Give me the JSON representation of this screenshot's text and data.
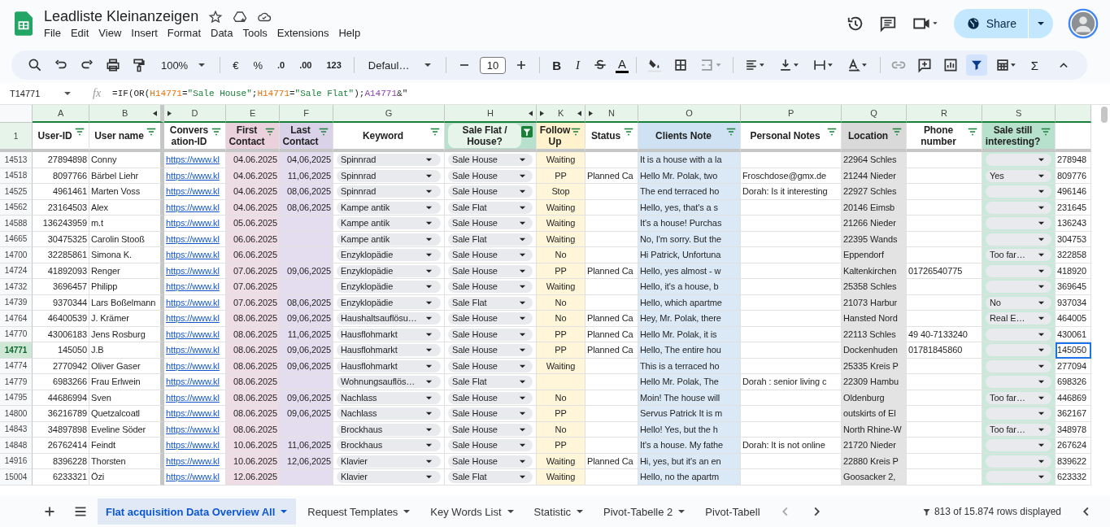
{
  "document": {
    "title": "Leadliste Kleinanzeigen"
  },
  "menu": [
    "File",
    "Edit",
    "View",
    "Insert",
    "Format",
    "Data",
    "Tools",
    "Extensions",
    "Help"
  ],
  "share": {
    "label": "Share"
  },
  "toolbar": {
    "zoom": "100%",
    "currency": "€",
    "percent": "%",
    "decrease_decimals": ".0",
    "increase_decimals": ".00",
    "number_format": "123",
    "font": "Defaul…",
    "font_size": "10",
    "bold": "B",
    "italic": "I",
    "text_color": "A",
    "sum": "Σ",
    "filter_on": true
  },
  "formula_bar": {
    "name_box": "T14771",
    "fx": "fx",
    "tokens": [
      {
        "kind": "plain",
        "text": "=IF(OR("
      },
      {
        "kind": "ref",
        "text": "H14771",
        "color": "#e8710a"
      },
      {
        "kind": "plain",
        "text": "="
      },
      {
        "kind": "string",
        "text": "\"Sale House\""
      },
      {
        "kind": "plain",
        "text": ";"
      },
      {
        "kind": "ref",
        "text": "H14771",
        "color": "#e8710a"
      },
      {
        "kind": "plain",
        "text": "="
      },
      {
        "kind": "string",
        "text": "\"Sale Flat\""
      },
      {
        "kind": "plain",
        "text": ");"
      },
      {
        "kind": "ref",
        "text": "A14771",
        "color": "#8e44ad"
      },
      {
        "kind": "plain",
        "text": "&\""
      }
    ]
  },
  "grid": {
    "header_row_number": "1",
    "columns": [
      {
        "letter": "A",
        "header": "User-ID",
        "kind": "number",
        "filter_active": false
      },
      {
        "letter": "B",
        "header": "User name",
        "kind": "text",
        "filter_active": false
      },
      {
        "letter": "D",
        "header": "Convers ation-ID",
        "kind": "link",
        "filter_active": false
      },
      {
        "letter": "E",
        "header": "First Contact",
        "kind": "number",
        "filter_active": false,
        "color": "#ead1dc",
        "filled": true
      },
      {
        "letter": "F",
        "header": "Last Contact",
        "kind": "number",
        "filter_active": false,
        "color": "#d9d2e9",
        "filled": true
      },
      {
        "letter": "G",
        "header": "Keyword",
        "kind": "dropdown",
        "filter_active": false
      },
      {
        "letter": "H",
        "header": "Sale Flat / House?",
        "kind": "dropdown",
        "filter_active": true,
        "color": "#b7e1cd",
        "filled": false
      },
      {
        "letter": "K",
        "header": "Follow Up",
        "kind": "center",
        "filter_active": false,
        "color": "#fff2cc",
        "filled": true
      },
      {
        "letter": "N",
        "header": "Status",
        "kind": "text",
        "filter_active": false
      },
      {
        "letter": "O",
        "header": "Clients Note",
        "kind": "text",
        "filter_active": false,
        "color": "#cfe2f3",
        "filled": true
      },
      {
        "letter": "P",
        "header": "Personal Notes",
        "kind": "text",
        "filter_active": false
      },
      {
        "letter": "Q",
        "header": "Location",
        "kind": "text",
        "filter_active": false,
        "color": "#d9d9d9",
        "filled": true
      },
      {
        "letter": "R",
        "header": "Phone number",
        "kind": "text",
        "filter_active": false
      },
      {
        "letter": "S",
        "header": "Sale still interesting?",
        "kind": "dropdown",
        "filter_active": false,
        "color": "#b7e1cd",
        "filled": true
      },
      {
        "kind": "text"
      }
    ],
    "rows": [
      {
        "number": "14513",
        "selected": false,
        "cells": [
          "27894898",
          "Conny",
          "https://www.kl",
          "04.06.2025",
          "04,06,2025",
          "Spinnrad",
          "Sale House",
          "Waiting",
          null,
          "It is a house with a la",
          null,
          "22964 Schles",
          null,
          null,
          "278948"
        ]
      },
      {
        "number": "14518",
        "selected": false,
        "cells": [
          "8097766",
          "Bärbel Liehr",
          "https://www.kl",
          "04.06.2025",
          "11,06,2025",
          "Spinnrad",
          "Sale House",
          "PP",
          "Planned Ca",
          "Hello Mr. Polak, two",
          "Froschdose@gmx.de",
          "21244 Nieder",
          null,
          "Yes",
          "809776"
        ]
      },
      {
        "number": "14525",
        "selected": false,
        "cells": [
          "4961461",
          "Marten Voss",
          "https://www.kl",
          "04.06.2025",
          "08,06,2025",
          "Spinnrad",
          "Sale House",
          "Stop",
          null,
          "The end terraced ho",
          "Dorah: Is it interesting",
          "22927 Schles",
          null,
          null,
          "496146"
        ]
      },
      {
        "number": "14562",
        "selected": false,
        "cells": [
          "23164503",
          "Alex",
          "https://www.kl",
          "04.06.2025",
          "08,06,2025",
          "Kampe antik",
          "Sale Flat",
          "Waiting",
          null,
          "Hello, yes, that's a s",
          null,
          "20146 Eimsb",
          null,
          null,
          "231645"
        ]
      },
      {
        "number": "14588",
        "selected": false,
        "cells": [
          "136243959",
          "m.t",
          "https://www.kl",
          "05.06.2025",
          null,
          "Kampe antik",
          "Sale House",
          "Waiting",
          null,
          "It's a house! Purchas",
          null,
          "21266 Nieder",
          null,
          null,
          "136243"
        ]
      },
      {
        "number": "14665",
        "selected": false,
        "cells": [
          "30475325",
          "Carolin Stooß",
          "https://www.kl",
          "06.06.2025",
          null,
          "Kampe antik",
          "Sale Flat",
          "Waiting",
          null,
          "No, I'm sorry. But the",
          null,
          "22395 Wands",
          null,
          null,
          "304753"
        ]
      },
      {
        "number": "14700",
        "selected": false,
        "cells": [
          "32285861",
          "Simona K.",
          "https://www.kl",
          "06.06.2025",
          null,
          "Enzyklopädie",
          "Sale House",
          "No",
          null,
          "Hi Patrick, Unfortuna",
          null,
          "Eppendorf",
          null,
          "Too far…",
          "322858"
        ]
      },
      {
        "number": "14724",
        "selected": false,
        "cells": [
          "41892093",
          "Renger",
          "https://www.kl",
          "07.06.2025",
          "09,06,2025",
          "Enzyklopädie",
          "Sale House",
          "PP",
          "Planned Ca",
          "Hello, yes almost - w",
          null,
          "Kaltenkirchen",
          "01726540775",
          null,
          "418920"
        ]
      },
      {
        "number": "14732",
        "selected": false,
        "cells": [
          "3696457",
          "Philipp",
          "https://www.kl",
          "07.06.2025",
          null,
          "Enzyklopädie",
          "Sale House",
          "Waiting",
          null,
          "Hello, it's a house, b",
          null,
          "25358 Schles",
          null,
          null,
          "369645"
        ]
      },
      {
        "number": "14739",
        "selected": false,
        "cells": [
          "9370344",
          "Lars Boßelmann",
          "https://www.kl",
          "07.06.2025",
          "08,06,2025",
          "Enzyklopädie",
          "Sale Flat",
          "No",
          null,
          "Hello, which apartme",
          null,
          "21073 Harbur",
          null,
          "No",
          "937034"
        ]
      },
      {
        "number": "14764",
        "selected": false,
        "cells": [
          "46400539",
          "J. Krämer",
          "https://www.kl",
          "08.06.2025",
          "09,06,2025",
          "Haushaltsauflösu…",
          "Sale House",
          "No",
          "Planned Ca",
          "Hey, Mr. Polak, there",
          null,
          "Hansted Nord",
          null,
          "Real E…",
          "464005"
        ]
      },
      {
        "number": "14770",
        "selected": false,
        "cells": [
          "43006183",
          "Jens Rosburg",
          "https://www.kl",
          "08.06.2025",
          "11,06,2025",
          "Hausflohmarkt",
          "Sale House",
          "PP",
          "Planned Ca",
          "Hello Mr. Polak, it is",
          null,
          "22113 Schles",
          "49 40-7133240",
          null,
          "430061"
        ]
      },
      {
        "number": "14771",
        "selected": true,
        "cells": [
          "145050",
          "J.B",
          "https://www.kl",
          "08.06.2025",
          "09,06,2025",
          "Hausflohmarkt",
          "Sale House",
          "PP",
          "Planned Ca",
          "Hello, The entire hou",
          null,
          "Dockenhuden",
          "01781845860",
          null,
          "145050"
        ]
      },
      {
        "number": "14774",
        "selected": false,
        "cells": [
          "2770942",
          "Oliver Gaser",
          "https://www.kl",
          "08.06.2025",
          "09,06,2025",
          "Hausflohmarkt",
          "Sale House",
          "Waiting",
          null,
          "This is a terraced ho",
          null,
          "25335 Kreis P",
          null,
          null,
          "277094"
        ]
      },
      {
        "number": "14779",
        "selected": false,
        "cells": [
          "6983266",
          "Frau Erlwein",
          "https://www.kl",
          "08.06.2025",
          null,
          "Wohnungsauflös…",
          "Sale Flat",
          null,
          null,
          "Hello Mr. Polak, The",
          "Dorah : senior living c",
          "22309 Hambu",
          null,
          null,
          "698326"
        ]
      },
      {
        "number": "14795",
        "selected": false,
        "cells": [
          "44686994",
          "Sven",
          "https://www.kl",
          "08.06.2025",
          "09,06,2025",
          "Nachlass",
          "Sale House",
          "No",
          null,
          "Moin! The house will",
          null,
          "Oldenburg",
          null,
          "Too far…",
          "446869"
        ]
      },
      {
        "number": "14800",
        "selected": false,
        "cells": [
          "36216789",
          "Quetzalcoatl",
          "https://www.kl",
          "08.06.2025",
          "09,06,2025",
          "Nachlass",
          "Sale House",
          "PP",
          null,
          "Servus Patrick It is m",
          null,
          "outskirts of El",
          null,
          null,
          "362167"
        ]
      },
      {
        "number": "14843",
        "selected": false,
        "cells": [
          "34897898",
          "Eveline Söder",
          "https://www.kl",
          "08.06.2025",
          null,
          "Brockhaus",
          "Sale House",
          "No",
          null,
          "Hello! Yes, but the h",
          null,
          "North Rhine-W",
          null,
          "Too far…",
          "348978"
        ]
      },
      {
        "number": "14848",
        "selected": false,
        "cells": [
          "26762414",
          "Feindt",
          "https://www.kl",
          "10.06.2025",
          "11,06,2025",
          "Brockhaus",
          "Sale House",
          "PP",
          null,
          "It's a house. My fathe",
          "Dorah: It is not online",
          "21720 Nieder",
          null,
          null,
          "267624"
        ]
      },
      {
        "number": "14916",
        "selected": false,
        "cells": [
          "8396228",
          "Thorsten",
          "https://www.kl",
          "10.06.2025",
          "12,06,2025",
          "Klavier",
          "Sale House",
          "Waiting",
          "Planned Ca",
          "Hi, yes, but it's an en",
          null,
          "22880 Kreis P",
          null,
          null,
          "839622"
        ]
      },
      {
        "number": "15004",
        "selected": false,
        "cells": [
          "6233321",
          "Özi",
          "https://www.kl",
          "12.06.2025",
          null,
          "Klavier",
          "Sale Flat",
          "Waiting",
          null,
          "Hello, no the apartm",
          null,
          "Goosacker 2,",
          null,
          null,
          "623332"
        ]
      }
    ]
  },
  "sheet_tabs": [
    {
      "label": "Flat acquisition Data Overview All",
      "selected": true
    },
    {
      "label": "Request Templates",
      "selected": false
    },
    {
      "label": "Key Words List",
      "selected": false
    },
    {
      "label": "Statistic",
      "selected": false
    },
    {
      "label": "Pivot-Tabelle 2",
      "selected": false
    },
    {
      "label": "Pivot-Tabell",
      "selected": false
    }
  ],
  "status": "813 of 15.874 rows displayed"
}
